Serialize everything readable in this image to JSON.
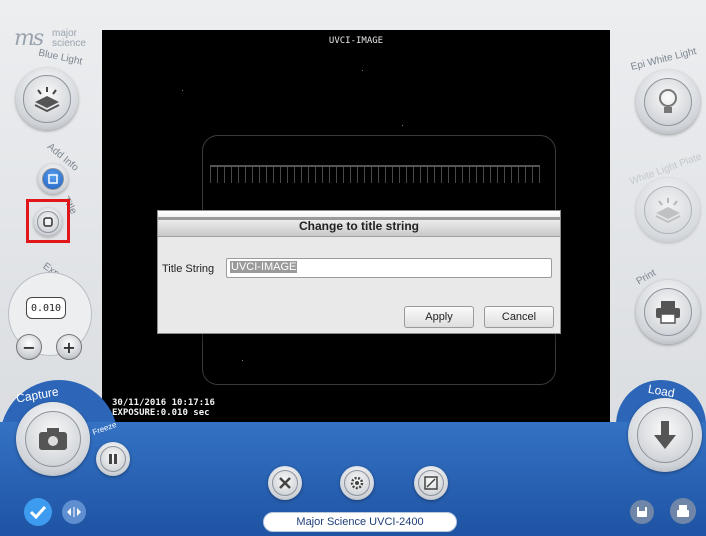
{
  "logo": {
    "mark": "ms",
    "line1": "major",
    "line2": "science"
  },
  "left_panel": {
    "blue_light_label": "Blue Light",
    "add_info_label": "Add Info",
    "title_label": "Title",
    "exposure_label": "Exposure",
    "exposure_value": "0.010",
    "minus": "−",
    "plus": "+",
    "capture_label": "Capture",
    "freeze_label": "Freeze"
  },
  "right_panel": {
    "epi_white_label": "Epi White Light",
    "white_plate_label": "White Light Plate",
    "print_label": "Print",
    "load_label": "Load"
  },
  "image": {
    "title": "UVCI-IMAGE",
    "timestamp": "30/11/2016 10:17:16",
    "exposure": "EXPOSURE:0.010 sec"
  },
  "dialog": {
    "title": "Change to title string",
    "field_label": "Title String",
    "field_value": "UVCI-IMAGE",
    "apply_label": "Apply",
    "cancel_label": "Cancel"
  },
  "status_bar": {
    "text": "Major Science UVCI-2400"
  },
  "colors": {
    "accent_blue": "#2a62b4",
    "highlight_red": "#e0161a"
  }
}
